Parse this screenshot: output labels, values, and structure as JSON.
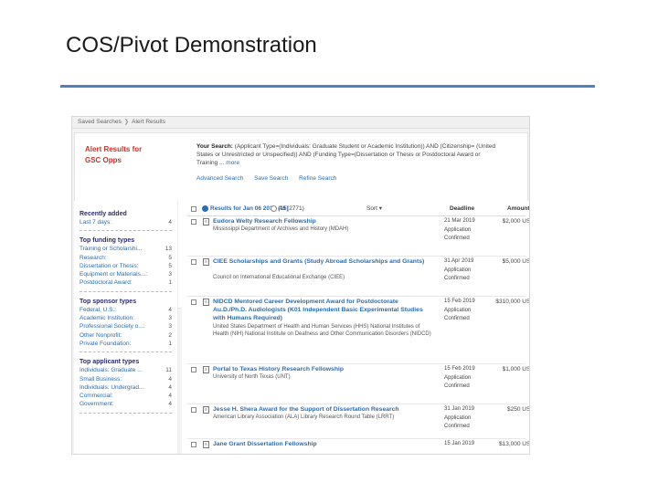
{
  "slide": {
    "title": "COS/Pivot Demonstration"
  },
  "breadcrumb": [
    "Saved Searches",
    "Alert Results"
  ],
  "alert": {
    "title_line1": "Alert Results for",
    "title_line2": "GSC Opps",
    "your_search_label": "Your Search:",
    "your_search_text": "(Applicant Type=(Individuals: Graduate Student or Academic Institution)) AND (Citizenship= (United States or Unrestricted or Unspecified)) AND (Funding Type=(Dissertation or Thesis or Postdoctoral Award or Training ...",
    "more": "more",
    "actions": [
      "Advanced Search",
      "Save Search",
      "Refine Search"
    ]
  },
  "sidebar": {
    "recently_added": {
      "heading": "Recently added",
      "items": [
        {
          "label": "Last 7 days:",
          "count": "4"
        }
      ]
    },
    "funding_types": {
      "heading": "Top funding types",
      "items": [
        {
          "label": "Training or Scholarshi...",
          "count": "13"
        },
        {
          "label": "Research:",
          "count": "5"
        },
        {
          "label": "Dissertation or Thesis:",
          "count": "5"
        },
        {
          "label": "Equipment or Materials...:",
          "count": "3"
        },
        {
          "label": "Postdoctoral Award:",
          "count": "1"
        }
      ]
    },
    "sponsor_types": {
      "heading": "Top sponsor types",
      "items": [
        {
          "label": "Federal, U.S.:",
          "count": "4"
        },
        {
          "label": "Academic Institution:",
          "count": "3"
        },
        {
          "label": "Professional Society o...:",
          "count": "3"
        },
        {
          "label": "Other Nonprofit:",
          "count": "2"
        },
        {
          "label": "Private Foundation:",
          "count": "1"
        }
      ]
    },
    "applicant_types": {
      "heading": "Top applicant types",
      "items": [
        {
          "label": "Individuals: Graduate ...",
          "count": "11"
        },
        {
          "label": "Small Business:",
          "count": "4"
        },
        {
          "label": "Individuals: Undergrad...",
          "count": "4"
        },
        {
          "label": "Commercial:",
          "count": "4"
        },
        {
          "label": "Government:",
          "count": "4"
        }
      ]
    }
  },
  "results": {
    "header": {
      "selected_label": "Results for Jan 06 2019 (15)",
      "all_label": "All (2771)",
      "sort_label": "Sort ▾",
      "deadline_label": "Deadline",
      "amount_label": "Amount"
    },
    "rows": [
      {
        "title": "Eudora Welty Research Fellowship",
        "sponsor": "Mississippi Department of Archives and History (MDAH)",
        "deadline": "21 Mar 2019",
        "status1": "Application",
        "status2": "Confirmed",
        "amount": "$2,000 USD"
      },
      {
        "title": "CIEE Scholarships and Grants (Study Abroad Scholarships and Grants)",
        "sponsor": "Council on International Educational Exchange (CIEE)",
        "deadline": "31 Apr 2019",
        "status1": "Application",
        "status2": "Confirmed",
        "amount": "$5,000 USD"
      },
      {
        "title": "NIDCD Mentored Career Development Award for Postdoctorate Au.D./Ph.D. Audiologists (K01 Independent Basic Experimental Studies with Humans Required)",
        "sponsor": "United States Department of Health and Human Services (HHS) National Institutes of Health (NIH) National Institute on Deafness and Other Communication Disorders (NIDCD)",
        "deadline": "15 Feb 2019",
        "status1": "Application",
        "status2": "Confirmed",
        "amount": "$310,000 USD"
      },
      {
        "title": "Portal to Texas History Research Fellowship",
        "sponsor": "University of North Texas (UNT)",
        "deadline": "15 Feb 2019",
        "status1": "Application",
        "status2": "Confirmed",
        "amount": "$1,000 USD"
      },
      {
        "title": "Jesse H. Shera Award for the Support of Dissertation Research",
        "sponsor": "American Library Association (ALA) Library Research Round Table (LRRT)",
        "deadline": "31 Jan 2019",
        "status1": "Application",
        "status2": "Confirmed",
        "amount": "$250 USD"
      },
      {
        "title": "Jane Grant Dissertation Fellowship",
        "sponsor": "",
        "deadline": "15 Jan 2019",
        "status1": "",
        "status2": "",
        "amount": "$13,000 USD"
      }
    ]
  }
}
